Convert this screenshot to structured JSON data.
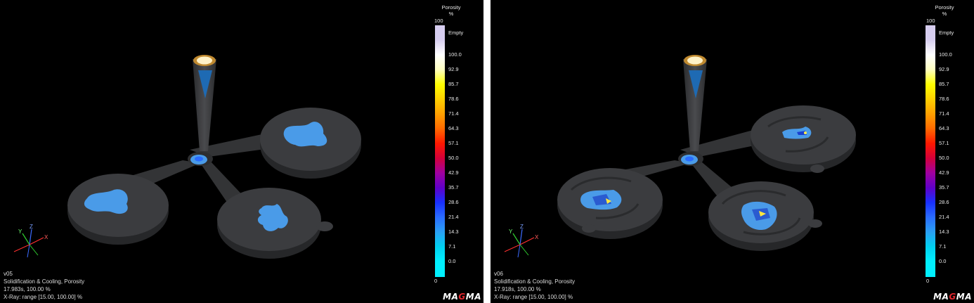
{
  "legend": {
    "title_line1": "Porosity",
    "title_line2": "%",
    "top_value": "100",
    "bottom_value": "0",
    "empty_label": "Empty",
    "ticks": [
      "100.0",
      "92.9",
      "85.7",
      "78.6",
      "71.4",
      "64.3",
      "57.1",
      "50.0",
      "42.9",
      "35.7",
      "28.6",
      "21.4",
      "14.3",
      "7.1",
      "0.0"
    ],
    "colors": [
      "#ffffff",
      "#ffffc0",
      "#ffff00",
      "#ffd000",
      "#ffa000",
      "#ff6a00",
      "#ff1800",
      "#d4003a",
      "#a000a0",
      "#6000c8",
      "#1830ff",
      "#2a6cff",
      "#2aa0f4",
      "#00d0f0",
      "#00f0ff"
    ],
    "empty_color": "#d6cdef"
  },
  "axes": {
    "x": "X",
    "y": "Y",
    "z": "Z"
  },
  "panels": [
    {
      "version": "v05",
      "module": "Solidification & Cooling, Porosity",
      "time": "17.983s, 100.00 %",
      "xray": "X-Ray:  range [15.00, 100.00] %"
    },
    {
      "version": "v06",
      "module": "Solidification & Cooling, Porosity",
      "time": "17.918s, 100.00 %",
      "xray": "X-Ray:  range [15.00, 100.00] %"
    }
  ],
  "logo": {
    "part1": "MA",
    "accent": "G",
    "part2": "MA"
  },
  "colors": {
    "background": "#000000",
    "casting": "#3a3b3d",
    "porosity_blue": "#4a9be8",
    "divider": "#ffffff"
  }
}
